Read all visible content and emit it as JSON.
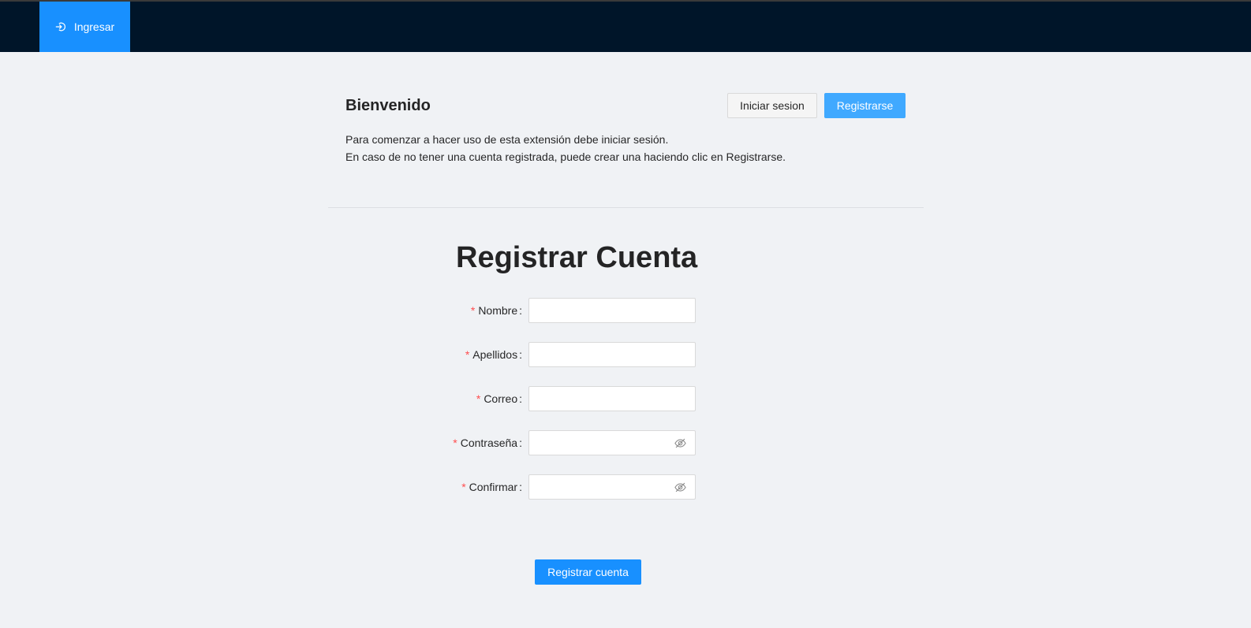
{
  "nav": {
    "login_item": {
      "label": "Ingresar",
      "icon": "login-icon",
      "color": "#1890ff"
    },
    "bar_color": "#001529"
  },
  "header": {
    "title": "Bienvenido",
    "login_button": "Iniciar sesion",
    "register_button": "Registrarse"
  },
  "intro": {
    "line1": "Para comenzar a hacer uso de esta extensión debe iniciar sesión.",
    "line2": "En caso de no tener una cuenta registrada, puede crear una haciendo clic en Registrarse."
  },
  "form": {
    "title": "Registrar Cuenta",
    "required_mark": "*",
    "fields": [
      {
        "label": "Nombre",
        "value": "",
        "type": "text"
      },
      {
        "label": "Apellidos",
        "value": "",
        "type": "text"
      },
      {
        "label": "Correo",
        "value": "",
        "type": "text"
      },
      {
        "label": "Contraseña",
        "value": "",
        "type": "password",
        "icon": "eye-invisible-icon"
      },
      {
        "label": "Confirmar",
        "value": "",
        "type": "password",
        "icon": "eye-invisible-icon"
      }
    ],
    "submit_label": "Registrar cuenta"
  },
  "colors": {
    "primary": "#1890ff",
    "primary_light": "#40a9ff",
    "required": "#ff4d4f",
    "background": "#f0f2f5"
  }
}
